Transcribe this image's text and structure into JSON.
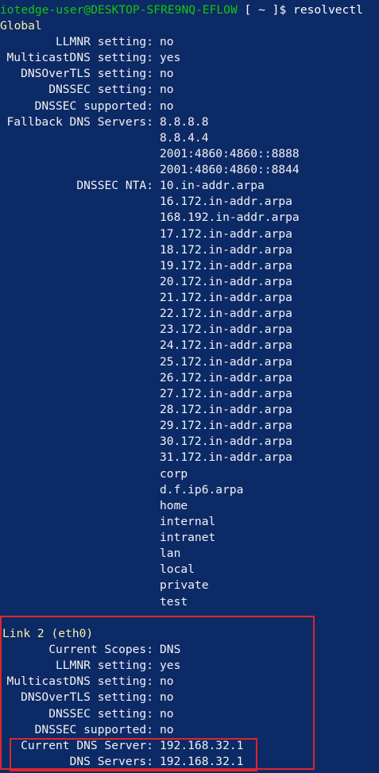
{
  "terminal": {
    "prompt": {
      "user_host": "iotedge-user@DESKTOP-SFRE9NQ-EFLOW",
      "path": " [ ~ ]$ ",
      "command": "resolvectl"
    },
    "global": {
      "header": "Global",
      "settings": [
        {
          "key": "LLMNR setting:",
          "value": "no"
        },
        {
          "key": "MulticastDNS setting:",
          "value": "yes"
        },
        {
          "key": "DNSOverTLS setting:",
          "value": "no"
        },
        {
          "key": "DNSSEC setting:",
          "value": "no"
        },
        {
          "key": "DNSSEC supported:",
          "value": "no"
        },
        {
          "key": "Fallback DNS Servers:",
          "value": "8.8.8.8"
        },
        {
          "key": "",
          "value": "8.8.4.4"
        },
        {
          "key": "",
          "value": "2001:4860:4860::8888"
        },
        {
          "key": "",
          "value": "2001:4860:4860::8844"
        },
        {
          "key": "DNSSEC NTA:",
          "value": "10.in-addr.arpa"
        },
        {
          "key": "",
          "value": "16.172.in-addr.arpa"
        },
        {
          "key": "",
          "value": "168.192.in-addr.arpa"
        },
        {
          "key": "",
          "value": "17.172.in-addr.arpa"
        },
        {
          "key": "",
          "value": "18.172.in-addr.arpa"
        },
        {
          "key": "",
          "value": "19.172.in-addr.arpa"
        },
        {
          "key": "",
          "value": "20.172.in-addr.arpa"
        },
        {
          "key": "",
          "value": "21.172.in-addr.arpa"
        },
        {
          "key": "",
          "value": "22.172.in-addr.arpa"
        },
        {
          "key": "",
          "value": "23.172.in-addr.arpa"
        },
        {
          "key": "",
          "value": "24.172.in-addr.arpa"
        },
        {
          "key": "",
          "value": "25.172.in-addr.arpa"
        },
        {
          "key": "",
          "value": "26.172.in-addr.arpa"
        },
        {
          "key": "",
          "value": "27.172.in-addr.arpa"
        },
        {
          "key": "",
          "value": "28.172.in-addr.arpa"
        },
        {
          "key": "",
          "value": "29.172.in-addr.arpa"
        },
        {
          "key": "",
          "value": "30.172.in-addr.arpa"
        },
        {
          "key": "",
          "value": "31.172.in-addr.arpa"
        },
        {
          "key": "",
          "value": "corp"
        },
        {
          "key": "",
          "value": "d.f.ip6.arpa"
        },
        {
          "key": "",
          "value": "home"
        },
        {
          "key": "",
          "value": "internal"
        },
        {
          "key": "",
          "value": "intranet"
        },
        {
          "key": "",
          "value": "lan"
        },
        {
          "key": "",
          "value": "local"
        },
        {
          "key": "",
          "value": "private"
        },
        {
          "key": "",
          "value": "test"
        }
      ]
    },
    "link": {
      "header": "Link 2 (eth0)",
      "settings": [
        {
          "key": "Current Scopes:",
          "value": "DNS"
        },
        {
          "key": "LLMNR setting:",
          "value": "yes"
        },
        {
          "key": "MulticastDNS setting:",
          "value": "no"
        },
        {
          "key": "DNSOverTLS setting:",
          "value": "no"
        },
        {
          "key": "DNSSEC setting:",
          "value": "no"
        },
        {
          "key": "DNSSEC supported:",
          "value": "no"
        },
        {
          "key": "Current DNS Server:",
          "value": "192.168.32.1"
        },
        {
          "key": "DNS Servers:",
          "value": "192.168.32.1"
        }
      ]
    },
    "colors": {
      "background": "#0c2a66",
      "text": "#f2f2f2",
      "prompt_user": "#16c60c",
      "header": "#f9f1a5",
      "highlight_border": "#e0242c"
    }
  }
}
